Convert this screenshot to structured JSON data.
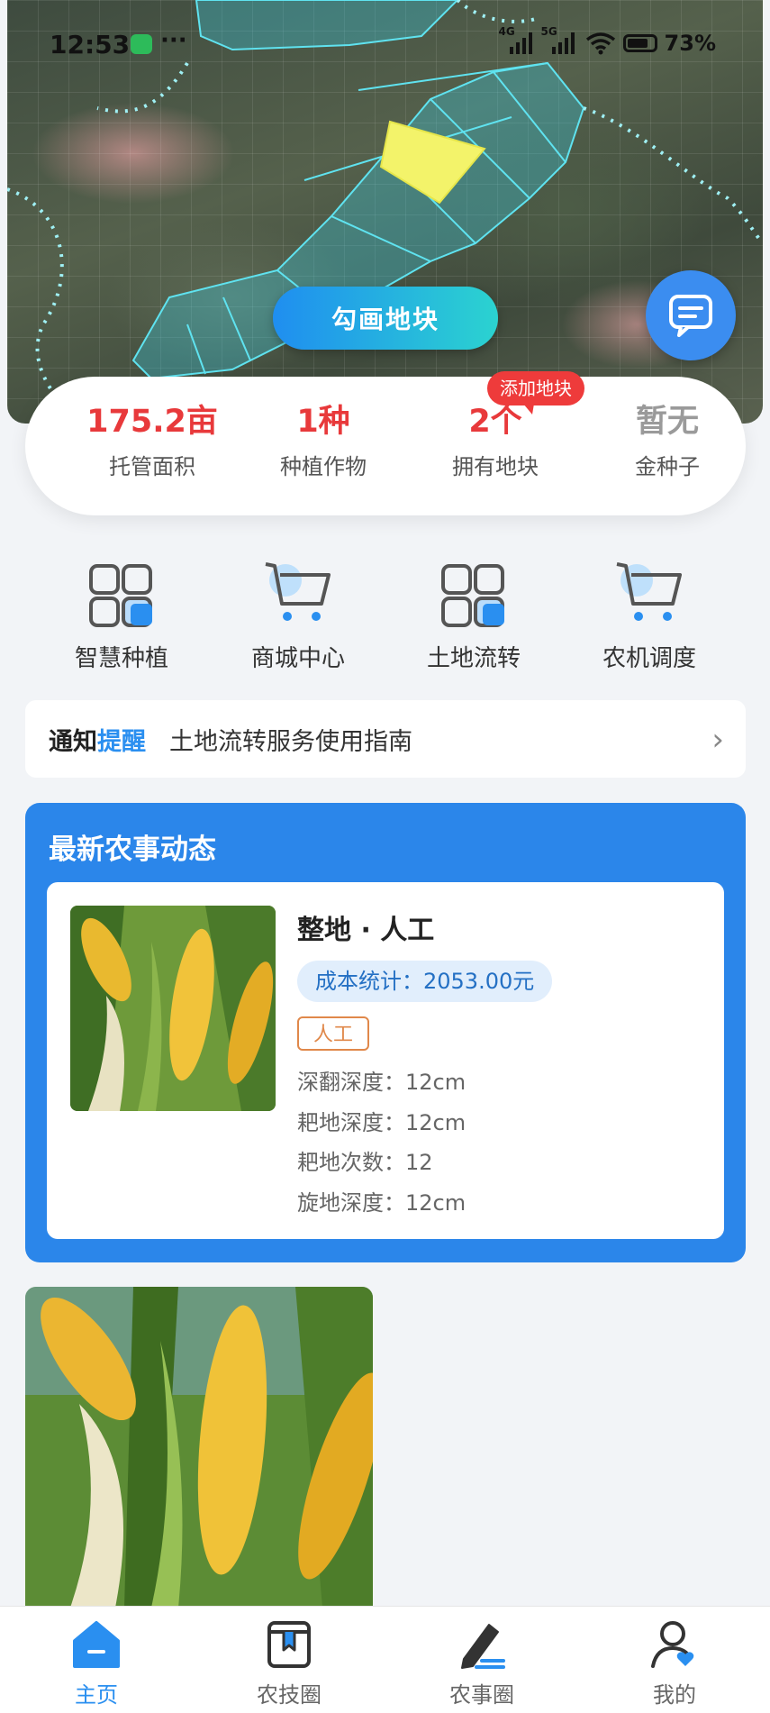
{
  "status": {
    "time": "12:53",
    "net1": "4G",
    "net2": "5G",
    "battery": "73%"
  },
  "map": {
    "draw_button": "勾画地块"
  },
  "stats": [
    {
      "value": "175.2亩",
      "label": "托管面积",
      "color": "red"
    },
    {
      "value": "1种",
      "label": "种植作物",
      "color": "red"
    },
    {
      "value": "2个",
      "label": "拥有地块",
      "color": "red",
      "badge": "添加地块"
    },
    {
      "value": "暂无",
      "label": "金种子",
      "color": "gray"
    }
  ],
  "nav": [
    {
      "label": "智慧种植",
      "icon": "grid-icon"
    },
    {
      "label": "商城中心",
      "icon": "cart-icon"
    },
    {
      "label": "土地流转",
      "icon": "grid-icon"
    },
    {
      "label": "农机调度",
      "icon": "cart-icon"
    }
  ],
  "notice": {
    "tag_a": "通知",
    "tag_b": "提醒",
    "text": "土地流转服务使用指南"
  },
  "activity": {
    "title": "最新农事动态",
    "task": "整地 · 人工",
    "cost": "成本统计：2053.00元",
    "tag": "人工",
    "details": [
      "深翻深度：12cm",
      "耙地深度：12cm",
      "耙地次数：12",
      "旋地深度：12cm"
    ]
  },
  "tabs": [
    {
      "label": "主页",
      "active": true
    },
    {
      "label": "农技圈",
      "active": false
    },
    {
      "label": "农事圈",
      "active": false
    },
    {
      "label": "我的",
      "active": false
    }
  ],
  "colors": {
    "accent": "#2a8ff0",
    "stat_red": "#e8393b",
    "card_blue": "#2b86ea",
    "badge_red": "#ee3b3b"
  }
}
